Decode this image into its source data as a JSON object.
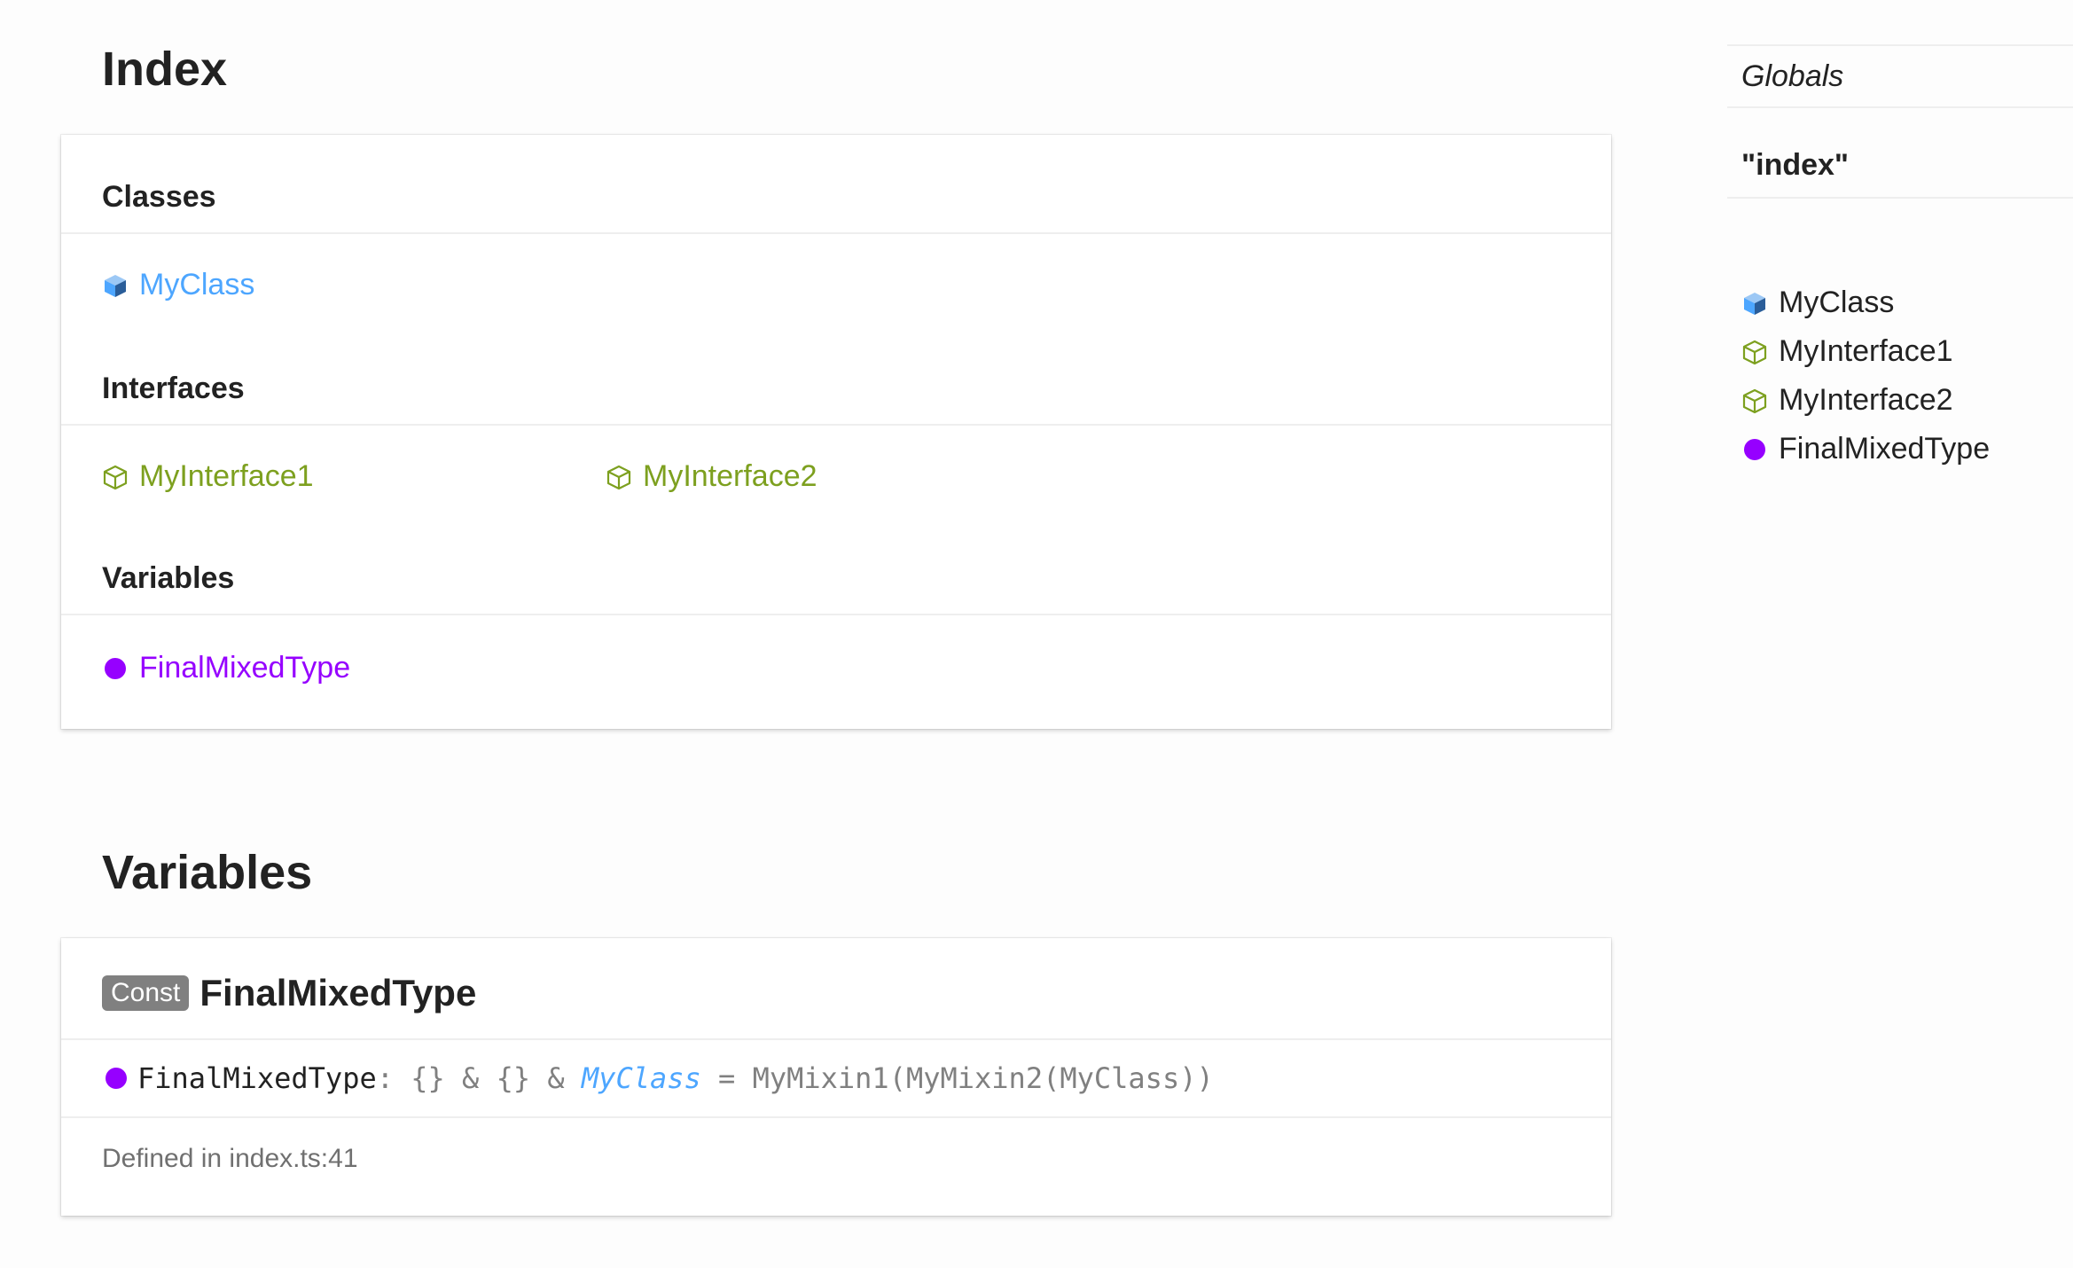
{
  "page": {
    "title": "Index"
  },
  "index": {
    "sections": [
      {
        "heading": "Classes",
        "items": [
          {
            "label": "MyClass",
            "kind": "class",
            "icon": "class-cube-icon",
            "color": "#4da6ff"
          }
        ]
      },
      {
        "heading": "Interfaces",
        "items": [
          {
            "label": "MyInterface1",
            "kind": "interface",
            "icon": "interface-cube-icon",
            "color": "#7da01f"
          },
          {
            "label": "MyInterface2",
            "kind": "interface",
            "icon": "interface-cube-icon",
            "color": "#7da01f"
          }
        ]
      },
      {
        "heading": "Variables",
        "items": [
          {
            "label": "FinalMixedType",
            "kind": "variable",
            "icon": "variable-dot-icon",
            "color": "#9600ff"
          }
        ]
      }
    ]
  },
  "variables_section": {
    "title": "Variables",
    "entry": {
      "badge": "Const",
      "name": "FinalMixedType",
      "signature": {
        "name": "FinalMixedType",
        "colon": ": ",
        "part1": "{} & {} & ",
        "type_link": "MyClass",
        "rest": " = MyMixin1(MyMixin2(MyClass))"
      },
      "defined_in": "Defined in index.ts:41"
    }
  },
  "sidebar": {
    "globals_label": "Globals",
    "module_label": "\"index\"",
    "items": [
      {
        "label": "MyClass",
        "icon": "class-cube-icon"
      },
      {
        "label": "MyInterface1",
        "icon": "interface-cube-icon"
      },
      {
        "label": "MyInterface2",
        "icon": "interface-cube-icon"
      },
      {
        "label": "FinalMixedType",
        "icon": "variable-dot-icon"
      }
    ]
  }
}
